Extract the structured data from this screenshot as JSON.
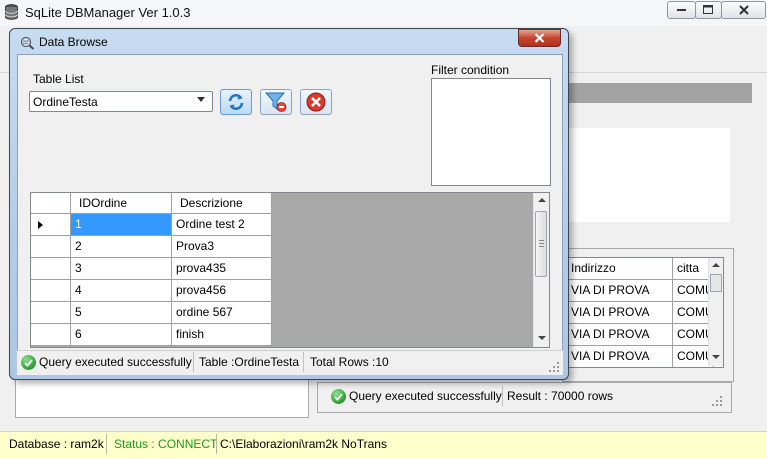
{
  "main_window": {
    "title": "SqLite DBManager Ver 1.0.3",
    "icon": "database-icon",
    "controls": {
      "minimize": "minimize-icon",
      "maximize": "maximize-icon",
      "close": "close-icon"
    }
  },
  "background_grid": {
    "columns": [
      "Indirizzo",
      "citta"
    ],
    "rows": [
      [
        "VIA DI PROVA",
        "COMU"
      ],
      [
        "VIA DI PROVA",
        "COMU"
      ],
      [
        "VIA DI PROVA",
        "COMU"
      ],
      [
        "VIA DI PROVA",
        "COMU"
      ]
    ]
  },
  "background_status": {
    "message": "Query executed successfully",
    "result": "Result : 70000 rows"
  },
  "main_status": {
    "database": "Database : ram2k",
    "status": "Status : CONNECT",
    "path": "C:\\Elaborazioni\\ram2k  NoTrans",
    "status_color": "#1a9b1a"
  },
  "dialog": {
    "title": "Data Browse",
    "table_list_label": "Table List",
    "selected_table": "OrdineTesta",
    "filter_label": "Filter condition",
    "filter_value": "",
    "buttons": {
      "refresh": "refresh-icon",
      "filter": "filter-icon",
      "clear": "clear-icon"
    },
    "grid": {
      "columns": [
        "IDOrdine",
        "Descrizione"
      ],
      "rows": [
        [
          "1",
          "Ordine test 2"
        ],
        [
          "2",
          "Prova3"
        ],
        [
          "3",
          "prova435"
        ],
        [
          "4",
          "prova456"
        ],
        [
          "5",
          "ordine 567"
        ],
        [
          "6",
          "finish"
        ]
      ],
      "selected_row": 0
    },
    "status": {
      "message": "Query executed successfully",
      "table": "Table :OrdineTesta",
      "total_rows": "Total Rows :10"
    }
  }
}
